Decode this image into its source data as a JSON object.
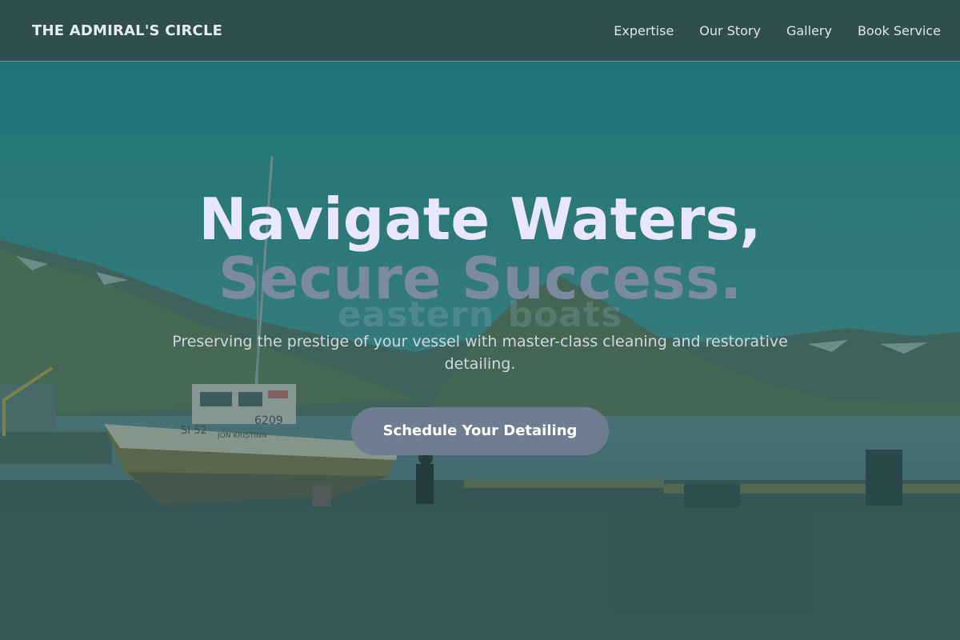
{
  "header": {
    "brand": "THE ADMIRAL'S CIRCLE",
    "nav": [
      "Expertise",
      "Our Story",
      "Gallery",
      "Book Service"
    ]
  },
  "hero": {
    "headline_line1": "Navigate Waters,",
    "headline_line2": "Secure Success.",
    "ghost_text": "eastern boats",
    "subtitle": "Preserving the prestige of your vessel with master-class cleaning and restorative detailing.",
    "cta_label": "Schedule Your Detailing"
  },
  "boat": {
    "hull_number": "6209",
    "registration": "SI 52",
    "name": "JON KRISTINN"
  },
  "colors": {
    "header_bg": "#314c4e",
    "headline": "#e9e7fb",
    "headline_accent": "#7b8aa0",
    "cta_bg": "#6f7d91",
    "overlay": "#2c4f50"
  }
}
